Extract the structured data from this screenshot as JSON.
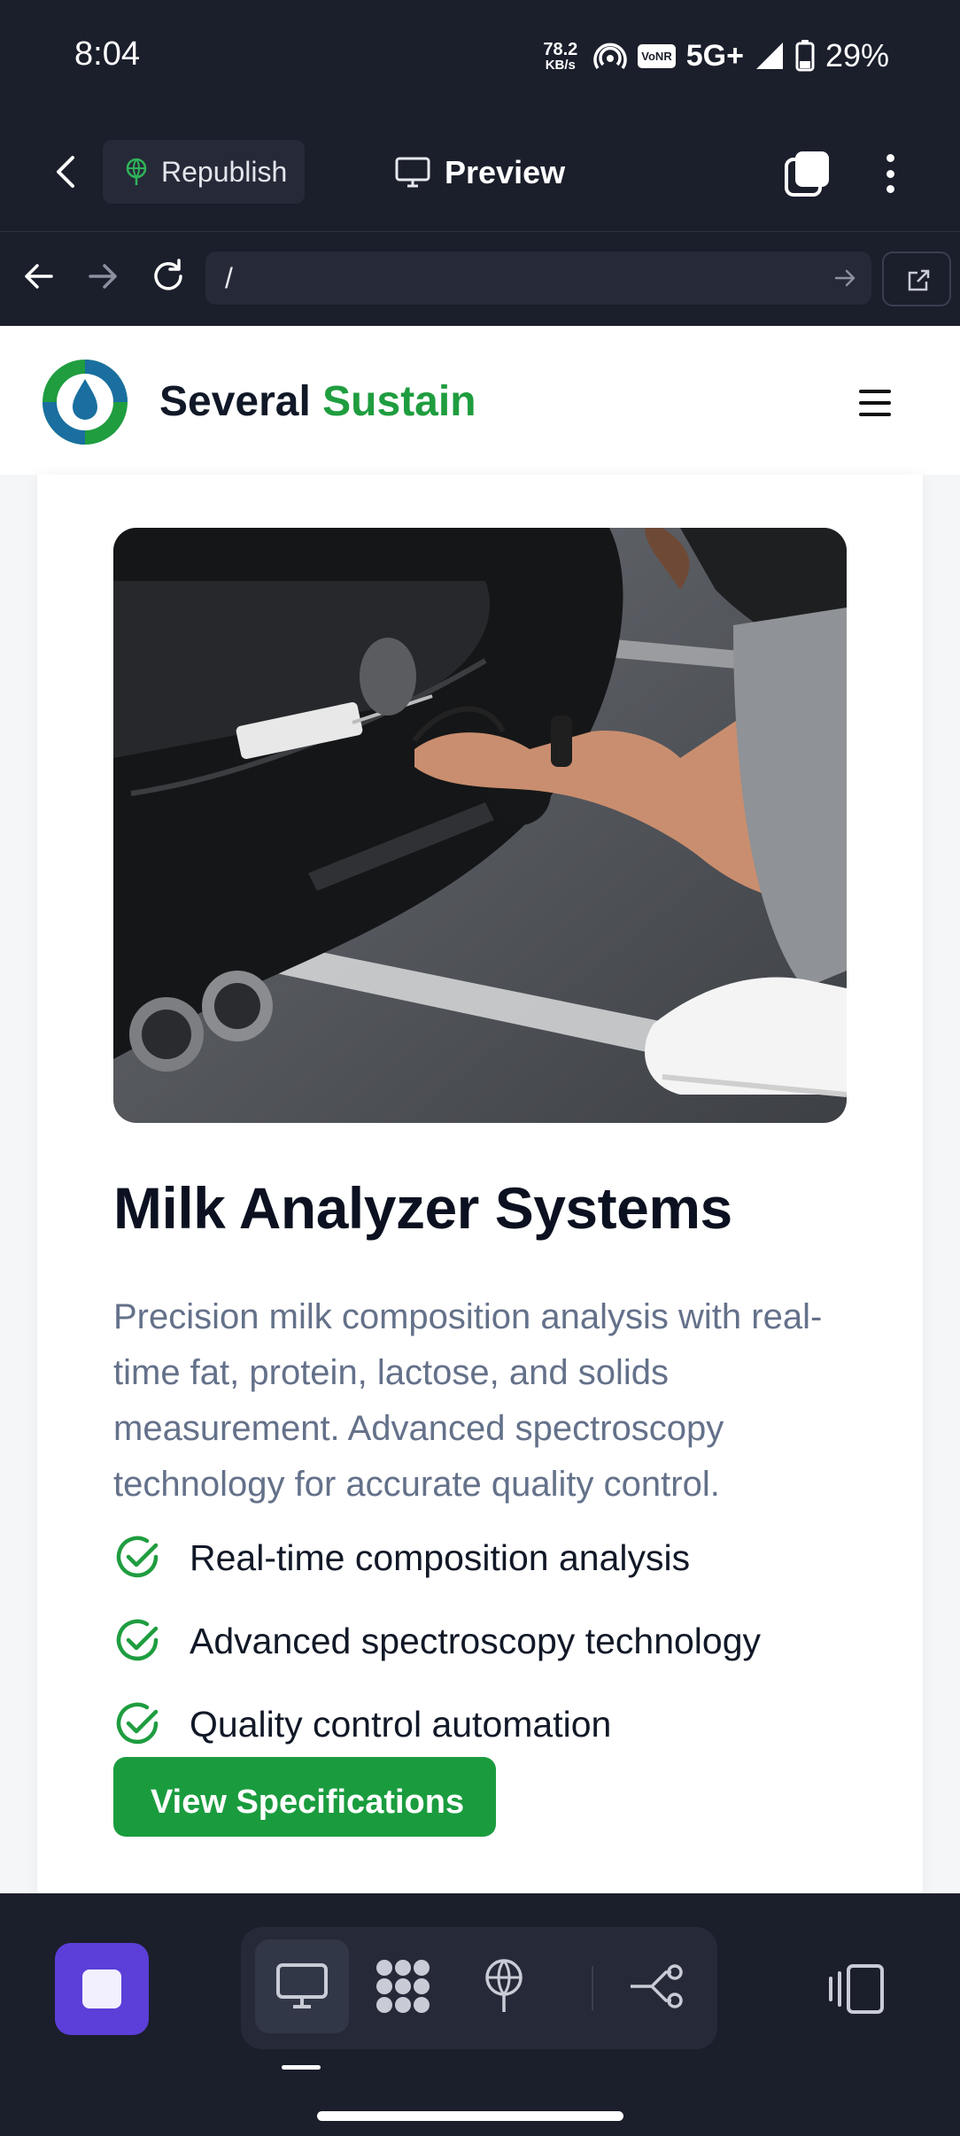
{
  "status_bar": {
    "time": "8:04",
    "speed_value": "78.2",
    "speed_unit": "KB/s",
    "vonr": "VoNR",
    "network": "5G+",
    "battery": "29%"
  },
  "editor_bar": {
    "republish_label": "Republish",
    "preview_label": "Preview"
  },
  "url_bar": {
    "url": "/"
  },
  "site": {
    "brand_first": "Several",
    "brand_second": "Sustain",
    "colors": {
      "brand_green": "#1f9d3f",
      "button_green": "#1a9c3e",
      "heading": "#0b1120",
      "muted": "#64718a"
    },
    "product": {
      "title": "Milk Analyzer Systems",
      "description": "Precision milk composition analysis with real-time fat, protein, lactose, and solids measurement. Advanced spectroscopy technology for accurate quality control.",
      "features": [
        "Real-time composition analysis",
        "Advanced spectroscopy technology",
        "Quality control automation"
      ],
      "cta_label": "View Specifications"
    }
  },
  "bottom_toolbar": {
    "accent": "#5b3fd8",
    "tools": [
      "monitor-icon",
      "grid-icon",
      "globe-pin-icon",
      "share-nodes-icon"
    ]
  }
}
